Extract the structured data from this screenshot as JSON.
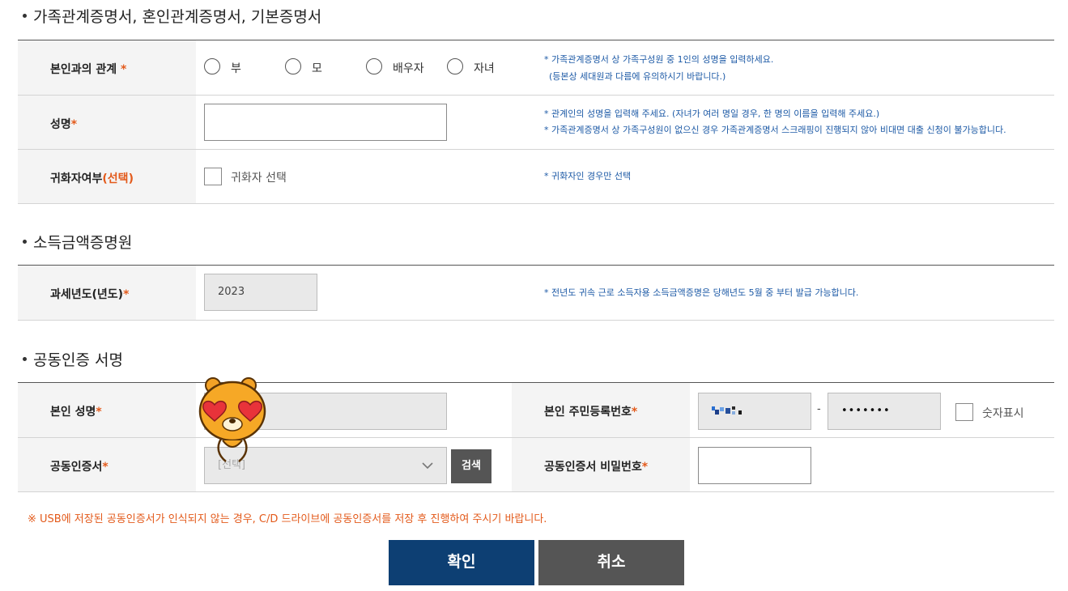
{
  "family": {
    "title": "가족관계증명서, 혼인관계증명서, 기본증명서",
    "relation": {
      "label": "본인과의 관계",
      "req": "*",
      "options": [
        "부",
        "모",
        "배우자",
        "자녀"
      ],
      "note1": "* 가족관계증명서 상 가족구성원 중 1인의 성명을 입력하세요.",
      "note2": "(등본상 세대원과 다름에 유의하시기 바랍니다.)"
    },
    "name": {
      "label": "성명",
      "req": "*",
      "value": "",
      "note1": "* 관계인의 성명을 입력해 주세요. (자녀가 여러 명일 경우, 한 명의 이름을 입력해 주세요.)",
      "note2": "* 가족관계증명서 상 가족구성원이 없으신 경우 가족관계증명서 스크래핑이 진행되지 않아 비대면 대출 신청이 불가능합니다."
    },
    "naturalized": {
      "label": "귀화자여부",
      "optional": "(선택)",
      "checkbox_label": "귀화자 선택",
      "note": "*  귀화자인 경우만 선택"
    }
  },
  "income": {
    "title": "소득금액증명원",
    "tax_year": {
      "label": "과세년도(년도)",
      "req": "*",
      "value": "2023",
      "note": "* 전년도 귀속 근로 소득자용 소득금액증명은 당해년도 5월 중 부터 발급 가능합니다."
    }
  },
  "cert": {
    "title": "공동인증 서명",
    "name": {
      "label": "본인 성명",
      "req": "*"
    },
    "rrn": {
      "label": "본인 주민등록번호",
      "req": "*",
      "dash": "-",
      "back_value": "•••••••",
      "show_digits": "숫자표시"
    },
    "certificate": {
      "label": "공동인증서",
      "req": "*",
      "placeholder": "[선택]",
      "search_button": "검색"
    },
    "password": {
      "label": "공동인증서 비밀번호",
      "req": "*"
    }
  },
  "warning": "※ USB에 저장된 공동인증서가 인식되지 않는 경우, C/D 드라이브에 공동인증서를 저장 후 진행하여 주시기 바랍니다.",
  "buttons": {
    "confirm": "확인",
    "cancel": "취소"
  },
  "colors": {
    "accent_orange": "#e35a1b",
    "note_blue": "#1d5aa6",
    "confirm_navy": "#0d3f73",
    "cancel_gray": "#555555"
  }
}
